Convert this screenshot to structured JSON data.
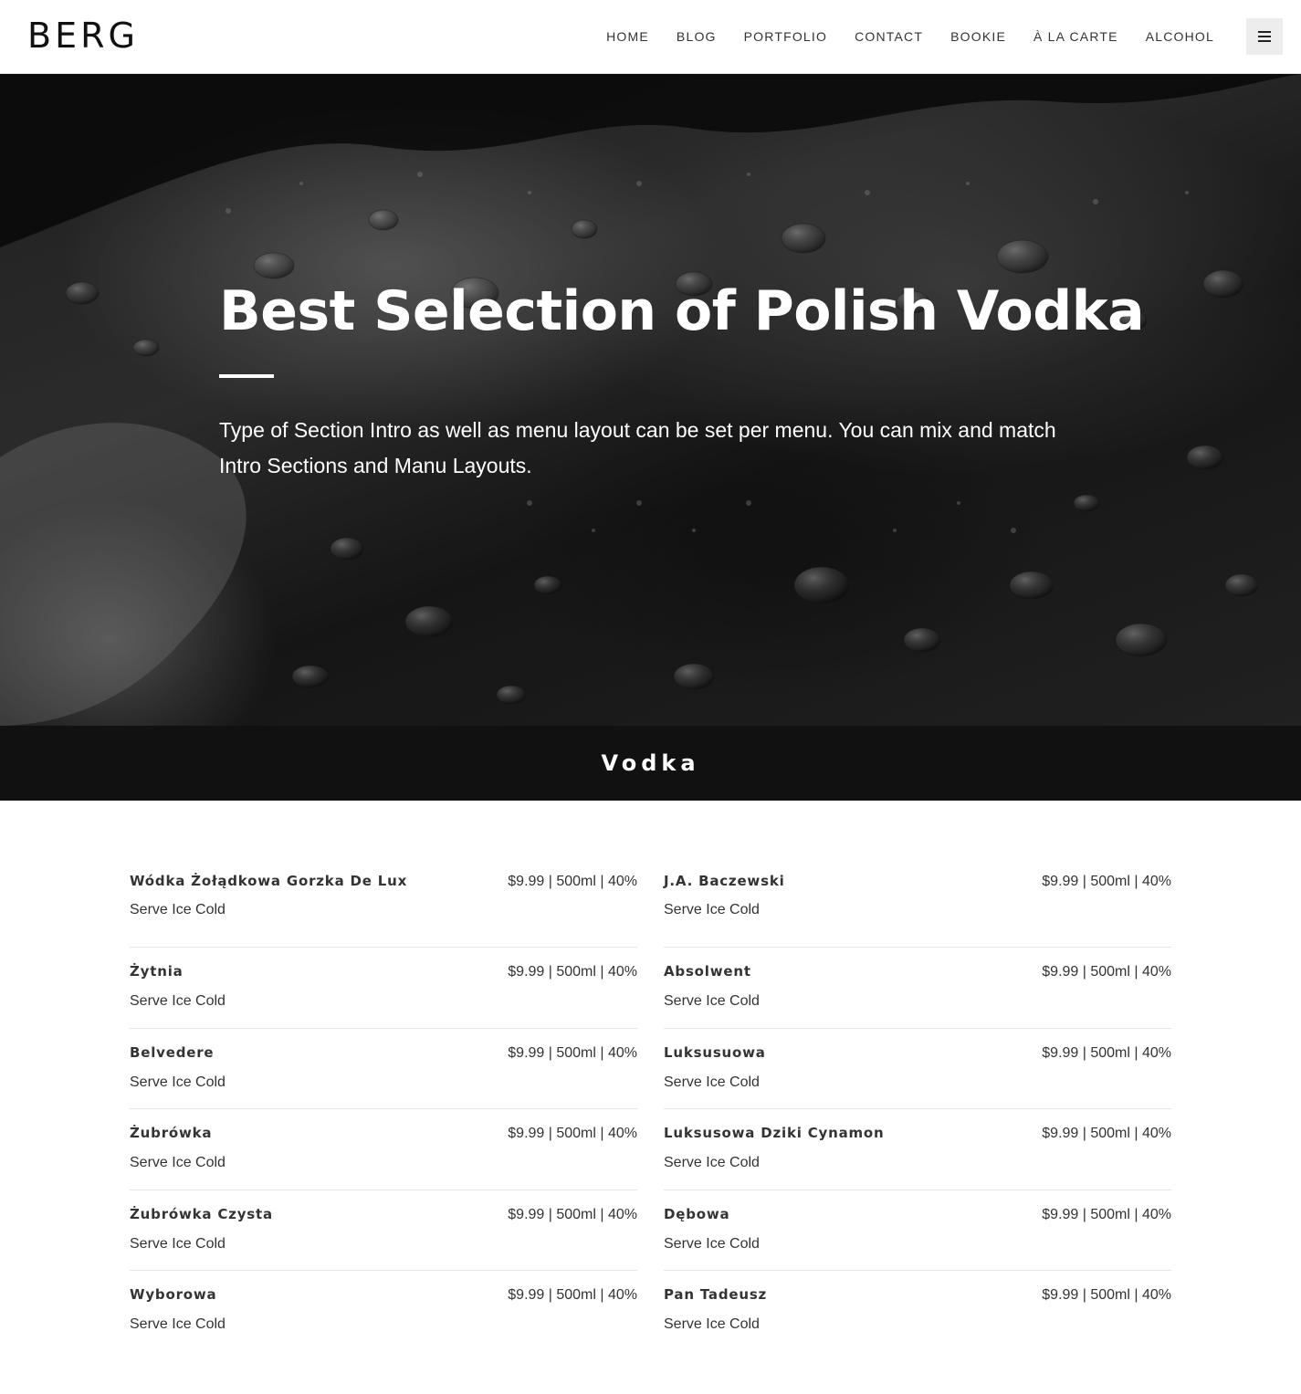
{
  "header": {
    "logo": "BERG",
    "nav": [
      "HOME",
      "BLOG",
      "PORTFOLIO",
      "CONTACT",
      "BOOKIE",
      "À LA CARTE",
      "ALCOHOL"
    ],
    "menu_icon": "hamburger-icon"
  },
  "hero": {
    "title": "Best Selection of Polish Vodka",
    "text": "Type of Section Intro as well as menu layout can be set per menu. You can mix and match Intro Sections and Manu Layouts."
  },
  "section": {
    "title": "Vodka"
  },
  "menu": {
    "left": [
      {
        "name": "Wódka Żołądkowa Gorzka De Lux",
        "price": "$9.99 | 500ml | 40%",
        "desc": "Serve Ice Cold"
      },
      {
        "name": "Żytnia",
        "price": "$9.99 | 500ml | 40%",
        "desc": "Serve Ice Cold"
      },
      {
        "name": "Belvedere",
        "price": "$9.99 | 500ml | 40%",
        "desc": "Serve Ice Cold"
      },
      {
        "name": "Żubrówka",
        "price": "$9.99 | 500ml | 40%",
        "desc": "Serve Ice Cold"
      },
      {
        "name": "Żubrówka Czysta",
        "price": "$9.99 | 500ml | 40%",
        "desc": "Serve Ice Cold"
      },
      {
        "name": "Wyborowa",
        "price": "$9.99 | 500ml | 40%",
        "desc": "Serve Ice Cold"
      }
    ],
    "right": [
      {
        "name": "J.A. Baczewski",
        "price": "$9.99 | 500ml | 40%",
        "desc": "Serve Ice Cold"
      },
      {
        "name": "Absolwent",
        "price": "$9.99 | 500ml | 40%",
        "desc": "Serve Ice Cold"
      },
      {
        "name": "Luksusuowa",
        "price": "$9.99 | 500ml | 40%",
        "desc": "Serve Ice Cold"
      },
      {
        "name": "Luksusowa Dziki Cynamon",
        "price": "$9.99 | 500ml | 40%",
        "desc": "Serve Ice Cold"
      },
      {
        "name": "Dębowa",
        "price": "$9.99 | 500ml | 40%",
        "desc": "Serve Ice Cold"
      },
      {
        "name": "Pan Tadeusz",
        "price": "$9.99 | 500ml | 40%",
        "desc": "Serve Ice Cold"
      }
    ]
  }
}
